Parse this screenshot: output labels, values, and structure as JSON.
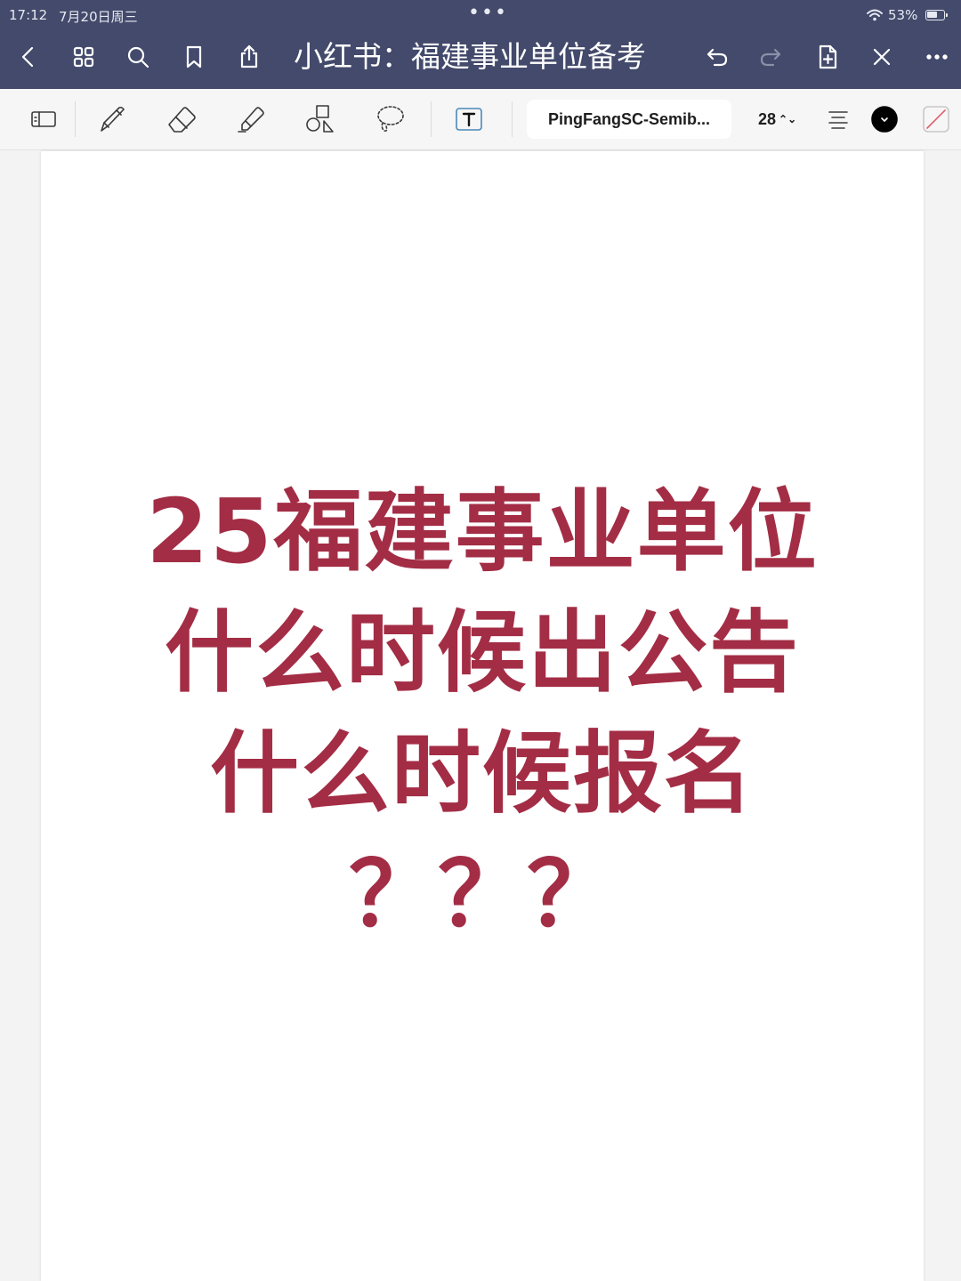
{
  "status_bar": {
    "time": "17:12",
    "date": "7月20日周三",
    "battery": "53%"
  },
  "nav": {
    "title": "小红书：福建事业单位备考",
    "icons": [
      "back-icon",
      "grid-icon",
      "search-icon",
      "bookmark-icon",
      "share-icon",
      "undo-icon",
      "redo-icon",
      "add-page-icon",
      "close-icon",
      "more-icon"
    ]
  },
  "toolbar": {
    "font_name": "PingFangSC-Semib...",
    "font_size": "28",
    "color": "#000000",
    "icons": [
      "layout-icon",
      "pen-icon",
      "eraser-icon",
      "highlighter-icon",
      "shapes-icon",
      "lasso-icon",
      "text-tool-icon",
      "align-icon"
    ]
  },
  "page": {
    "headline": {
      "line1": "25福建事业单位",
      "line2": "什么时候出公告",
      "line3": "什么时候报名",
      "line4": "？？？"
    },
    "text_color": "#a32d45"
  },
  "theme": {
    "appbar_color": "#434a6b",
    "toolbar_color": "#f6f6f6"
  }
}
